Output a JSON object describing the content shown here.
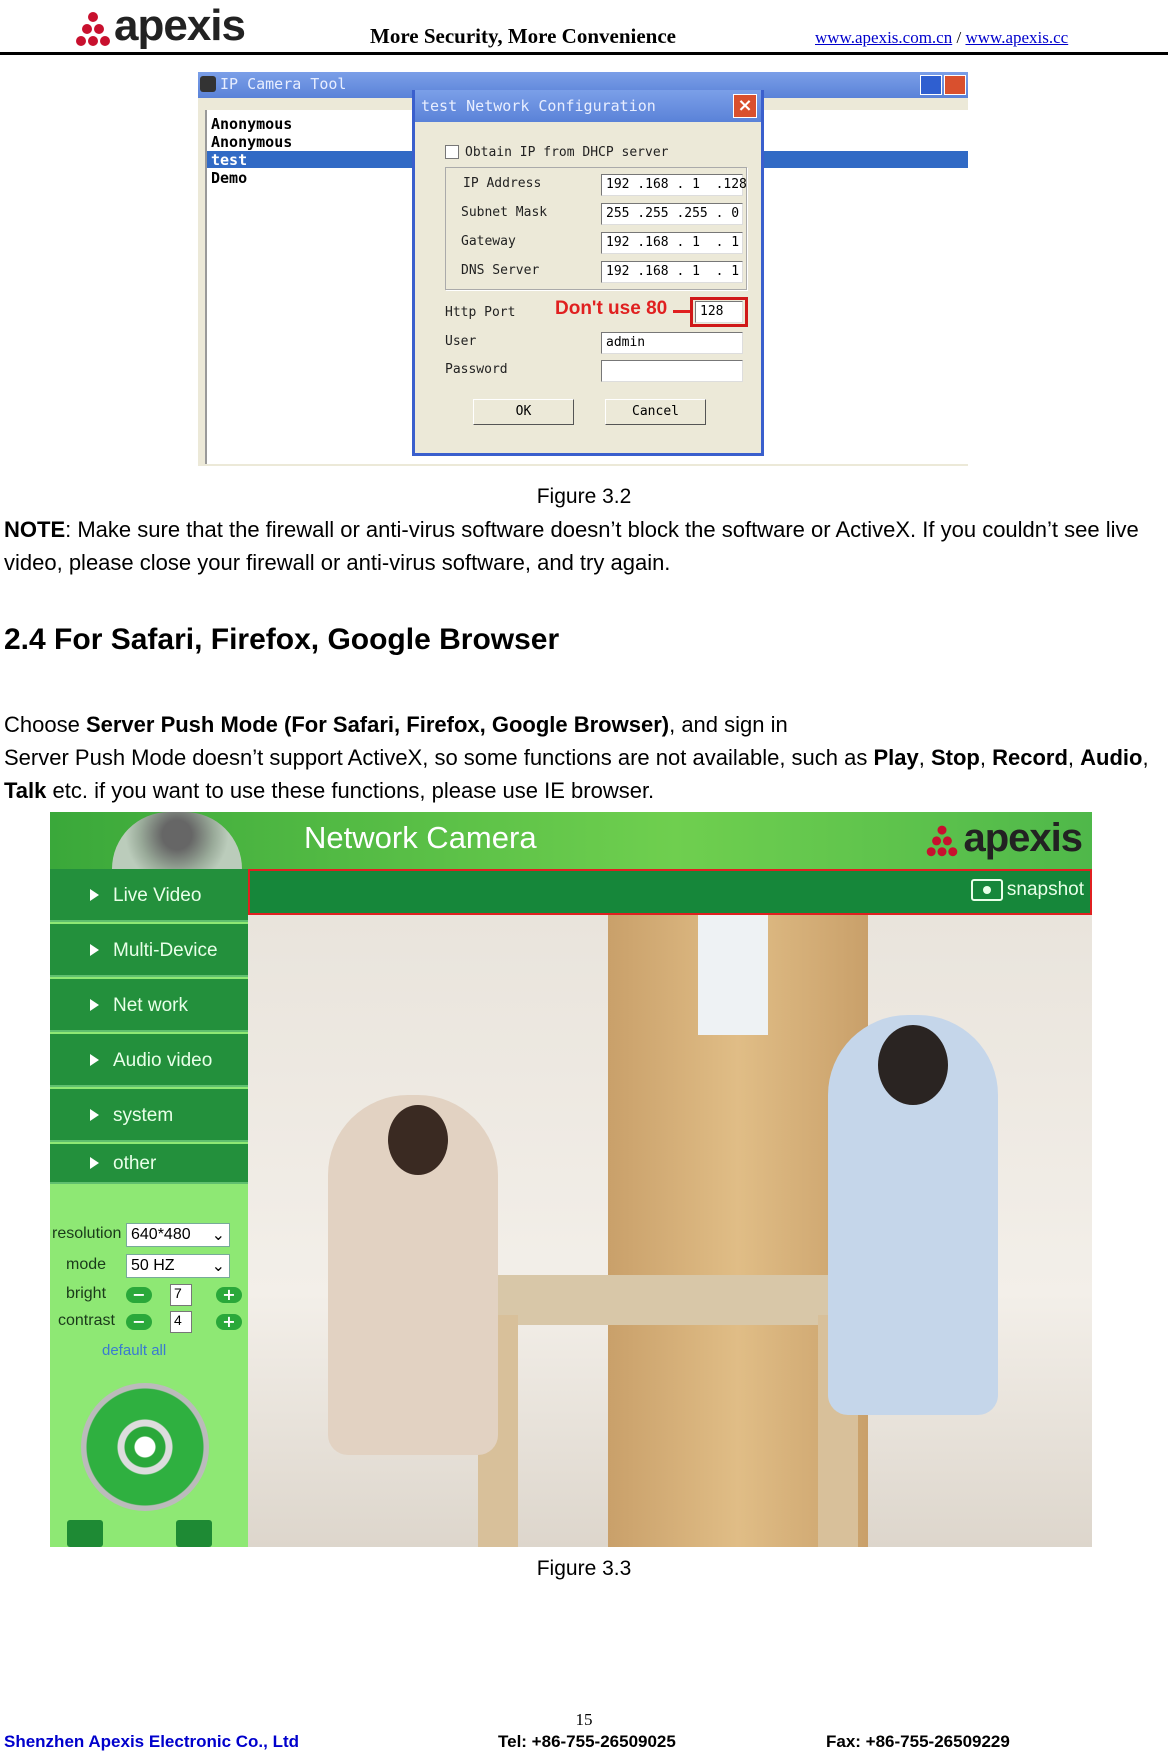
{
  "header": {
    "logo": "apexis",
    "tagline": "More Security, More Convenience",
    "link1": "www.apexis.com.cn",
    "separator": "/",
    "link2": "www.apexis.cc"
  },
  "figure32": {
    "window_title": "IP Camera Tool",
    "devices": [
      "Anonymous",
      "Anonymous",
      "test",
      "Demo"
    ],
    "selected_device": "test",
    "dialog_title": "test Network Configuration",
    "dhcp_label": "Obtain IP from DHCP server",
    "dhcp_checked": false,
    "fields": [
      {
        "label": "IP Address",
        "value": "192 .168 . 1  .128"
      },
      {
        "label": "Subnet Mask",
        "value": "255 .255 .255 . 0"
      },
      {
        "label": "Gateway",
        "value": "192 .168 . 1  . 1"
      },
      {
        "label": "DNS Server",
        "value": "192 .168 . 1  . 1"
      }
    ],
    "http_port_label": "Http Port",
    "http_port": "128",
    "annotation": "Don't use 80",
    "user_label": "User",
    "user": "admin",
    "password_label": "Password",
    "password": "",
    "ok": "OK",
    "cancel": "Cancel",
    "caption": "Figure 3.2"
  },
  "note": {
    "label": "NOTE",
    "text": ": Make sure that the firewall or anti-virus software doesn’t block the software or ActiveX. If you couldn’t see live video, please close your firewall or anti-virus software, and try again."
  },
  "section": {
    "heading": "2.4 For Safari, Firefox, Google Browser",
    "p1a": "Choose ",
    "p1b": "Server Push Mode (For Safari, Firefox, Google Browser)",
    "p1c": ", and sign in",
    "p2a": "Server Push Mode doesn’t support ActiveX, so some functions are not available, such as ",
    "play": "Play",
    "c1": ", ",
    "stop": "Stop",
    "c2": ", ",
    "record": "Record",
    "c3": ", ",
    "audio": "Audio",
    "c4": ", ",
    "talk": "Talk",
    "p2b": " etc. if you want to use these functions, please use IE browser."
  },
  "figure33": {
    "banner_title": "Network Camera",
    "logo": "apexis",
    "nav": [
      "Live Video",
      "Multi-Device",
      "Net work",
      "Audio video",
      "system",
      "other"
    ],
    "snapshot": "snapshot",
    "resolution_label": "resolution",
    "resolution": "640*480",
    "mode_label": "mode",
    "mode": "50 HZ",
    "bright_label": "bright",
    "bright": "7",
    "contrast_label": "contrast",
    "contrast": "4",
    "default_all": "default all",
    "caption": "Figure 3.3",
    "colors": {
      "nav": "#23903c",
      "panel": "#8ee874",
      "highlight": "#e02020"
    }
  },
  "footer": {
    "page": "15",
    "company": "Shenzhen Apexis Electronic Co., Ltd",
    "tel": "Tel: +86-755-26509025",
    "fax": "Fax: +86-755-26509229"
  }
}
